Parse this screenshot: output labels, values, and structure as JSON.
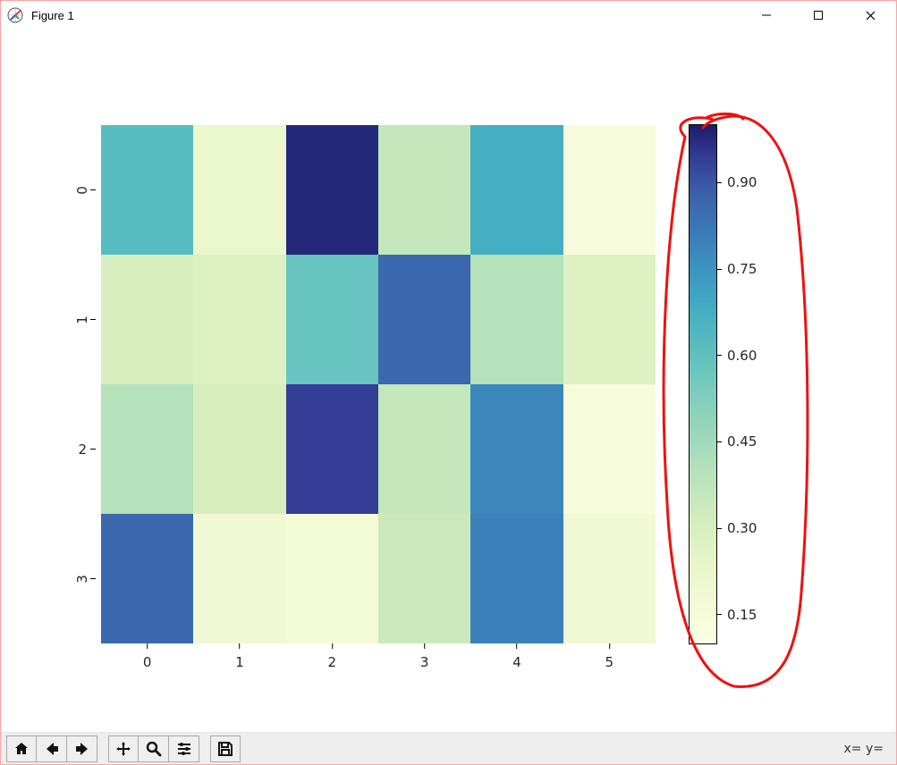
{
  "window": {
    "title": "Figure 1"
  },
  "chart_data": {
    "type": "heatmap",
    "x_categories": [
      "0",
      "1",
      "2",
      "3",
      "4",
      "5"
    ],
    "y_categories": [
      "0",
      "1",
      "2",
      "3"
    ],
    "values": [
      [
        0.62,
        0.22,
        0.98,
        0.36,
        0.68,
        0.14
      ],
      [
        0.3,
        0.28,
        0.58,
        0.86,
        0.4,
        0.28
      ],
      [
        0.4,
        0.3,
        0.94,
        0.36,
        0.78,
        0.14
      ],
      [
        0.86,
        0.18,
        0.16,
        0.34,
        0.8,
        0.18
      ]
    ],
    "colorbar": {
      "ticks": [
        "0.15",
        "0.30",
        "0.45",
        "0.60",
        "0.75",
        "0.90"
      ],
      "vmin": 0.1,
      "vmax": 1.0
    },
    "xlabel": "",
    "ylabel": "",
    "title": ""
  },
  "toolbar": {
    "coord_text": "x= y="
  }
}
